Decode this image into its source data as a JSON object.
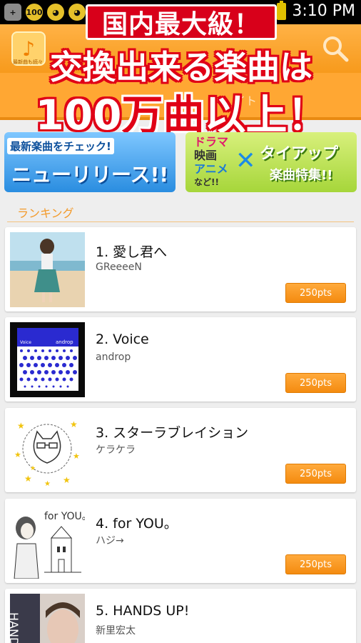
{
  "status_bar": {
    "time": "3:10 PM",
    "icons": [
      "add-icon",
      "counter-icon",
      "bear-icon",
      "bear-icon",
      "battery-icon"
    ],
    "counter_text": "100"
  },
  "app_bar": {
    "logo_caption": "最新曲も続々",
    "search_icon": "search-icon"
  },
  "tab_strip": {
    "visible_fragment": "イト"
  },
  "promo": {
    "line1": "国内最大級！",
    "line2": "交換出来る楽曲は",
    "line3_number": "100",
    "line3_red": "万曲",
    "line3_tail": "以上！"
  },
  "banners": {
    "new_release": {
      "subtitle": "最新楽曲をチェック!",
      "title": "ニューリリース!!"
    },
    "tie_up": {
      "word1": "ドラマ",
      "word2": "映画",
      "word3": "アニメ",
      "word4": "など!!",
      "cross": "✕",
      "title": "タイアップ",
      "subtitle": "楽曲特集!!"
    }
  },
  "ranking": {
    "title": "ランキング",
    "items": [
      {
        "title": "1. 愛し君へ",
        "artist": "GReeeeN",
        "price": "250pts"
      },
      {
        "title": "2. Voice",
        "artist": "androp",
        "price": "250pts"
      },
      {
        "title": "3. スターラブレイション",
        "artist": "ケラケラ",
        "price": "250pts"
      },
      {
        "title": "4. for YOU。",
        "artist": "ハジ→",
        "price": "250pts"
      },
      {
        "title": "5. HANDS UP!",
        "artist": "新里宏太",
        "price": "250pts"
      }
    ],
    "thumb_texts": {
      "voice_left": "Voice",
      "voice_right": "androp",
      "foryou": "for YOU。",
      "hands": "HANDS"
    }
  },
  "colors": {
    "accent": "#f79a1c",
    "promo_red": "#e00016",
    "button": "#f48b10"
  }
}
